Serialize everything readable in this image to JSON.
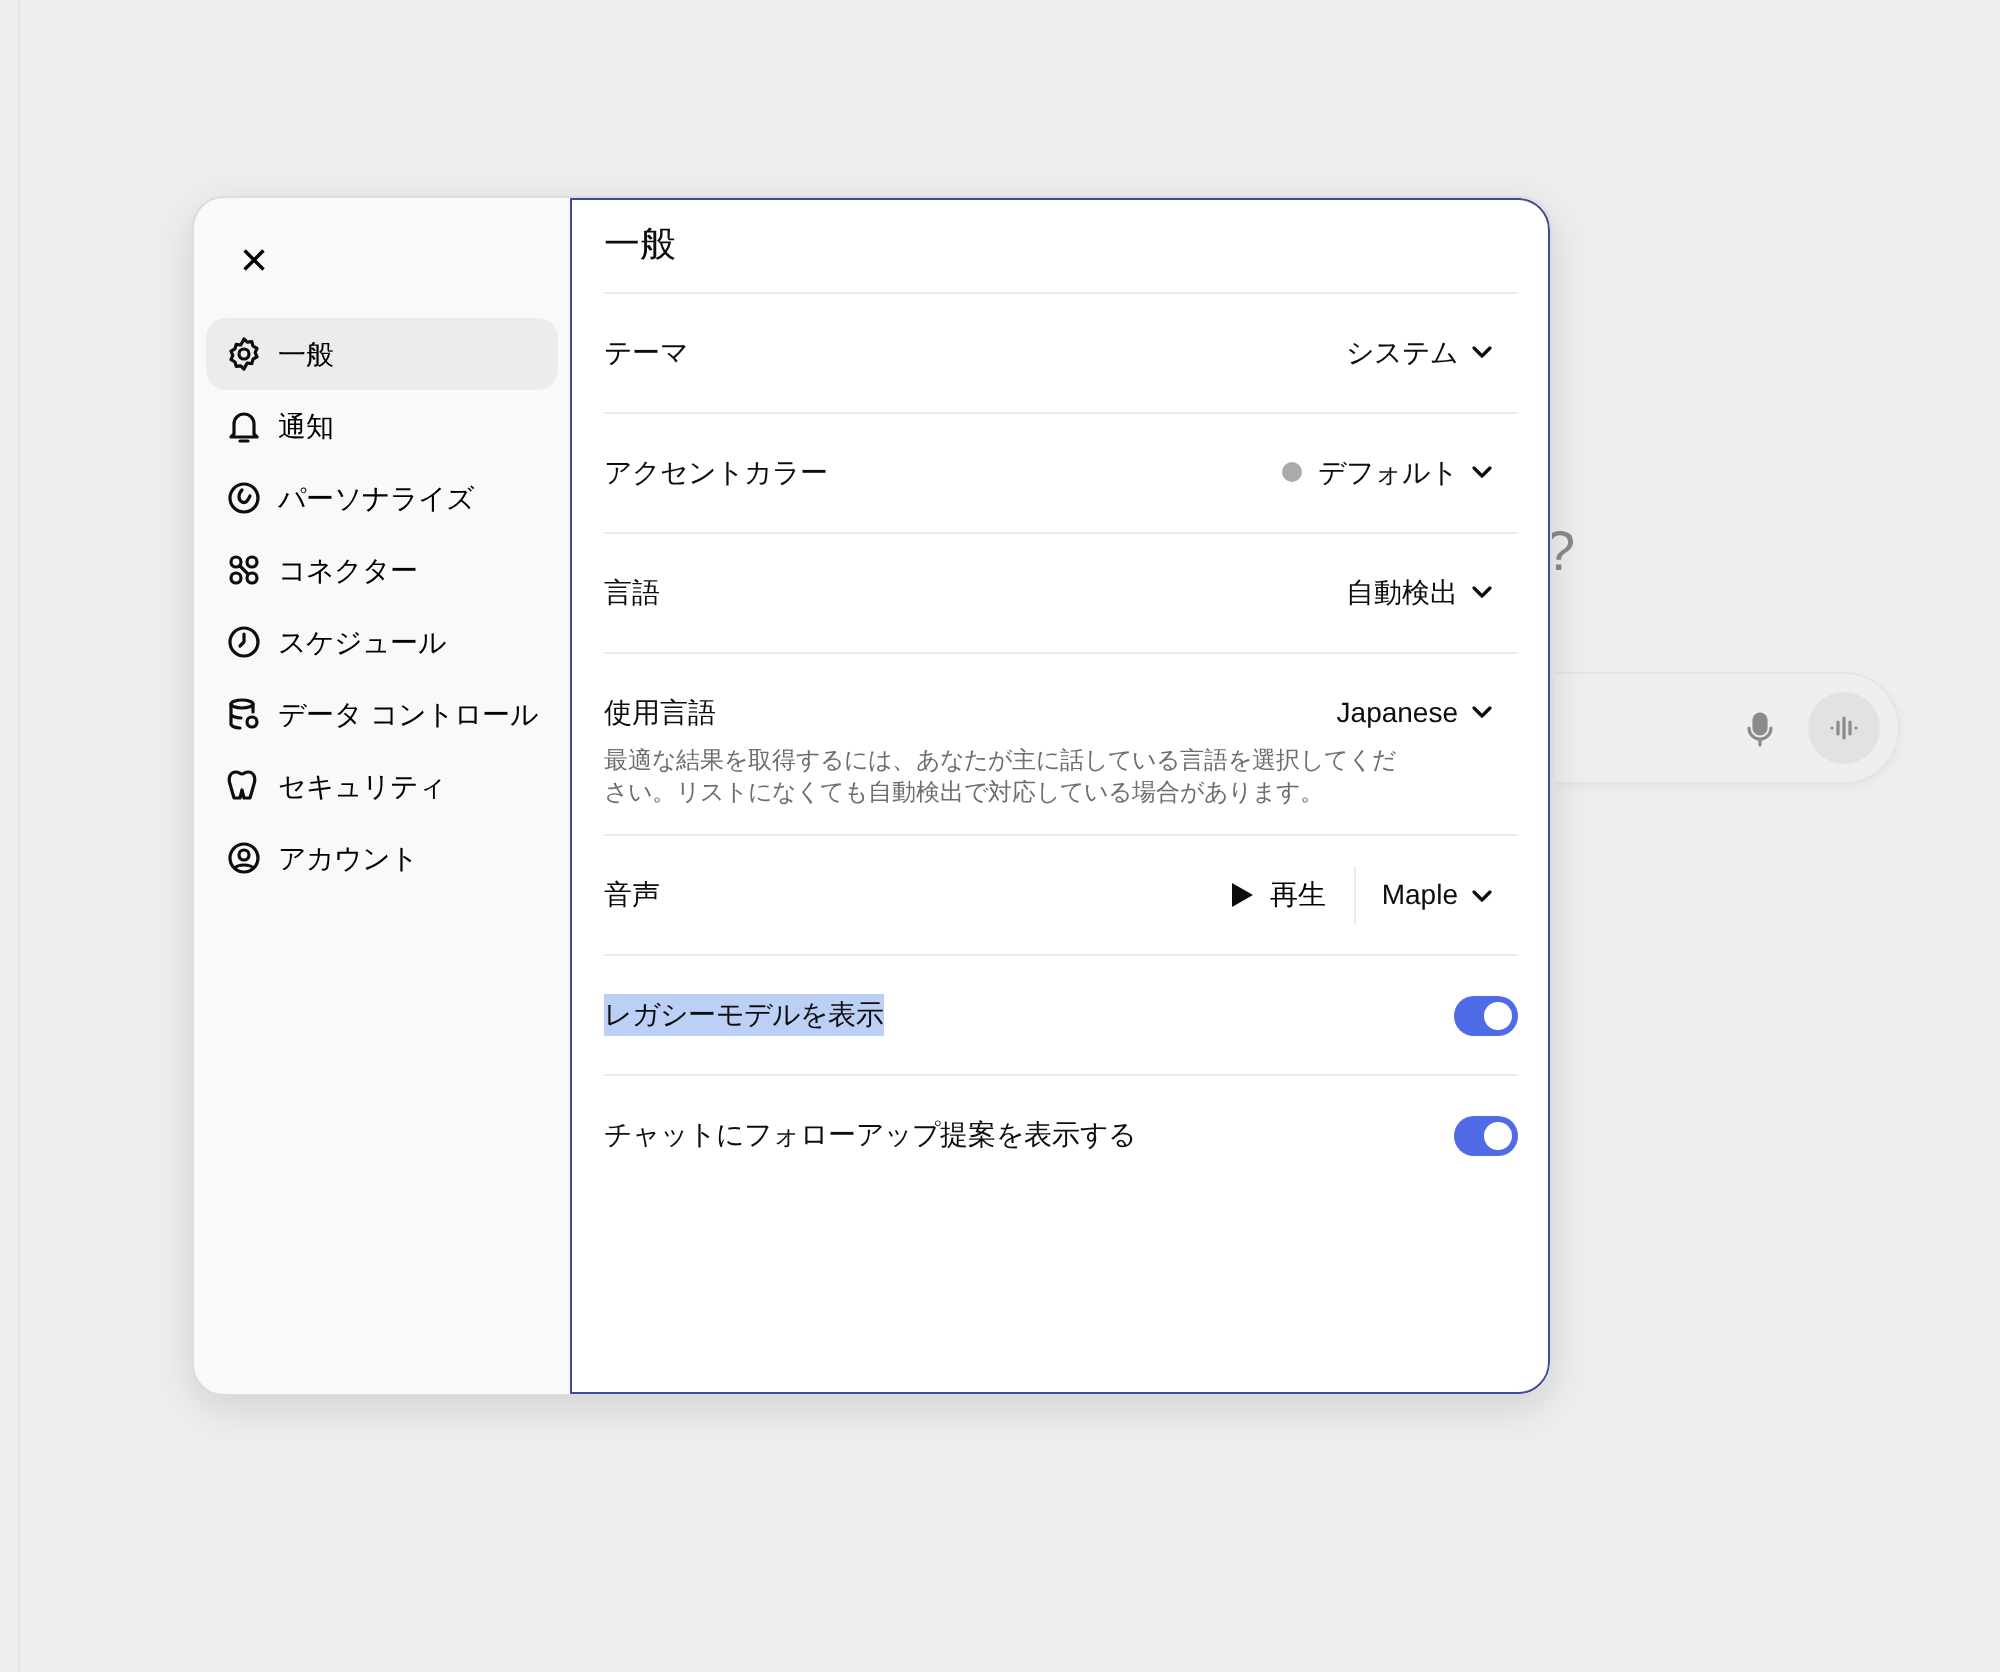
{
  "background": {
    "heading_fragment": "?"
  },
  "dialog": {
    "close": "×",
    "sidebar": [
      {
        "label": "一般",
        "selected": true
      },
      {
        "label": "通知",
        "selected": false
      },
      {
        "label": "パーソナライズ",
        "selected": false
      },
      {
        "label": "コネクター",
        "selected": false
      },
      {
        "label": "スケジュール",
        "selected": false
      },
      {
        "label": "データ コントロール",
        "selected": false
      },
      {
        "label": "セキュリティ",
        "selected": false
      },
      {
        "label": "アカウント",
        "selected": false
      }
    ],
    "title": "一般",
    "rows": [
      {
        "kind": "select",
        "label": "テーマ",
        "value": "システム"
      },
      {
        "kind": "select",
        "label": "アクセントカラー",
        "value": "デフォルト",
        "color": "#aaaaaa"
      },
      {
        "kind": "select",
        "label": "言語",
        "value": "自動検出"
      },
      {
        "kind": "select",
        "label": "使用言語",
        "value": "Japanese",
        "description": "最適な結果を取得するには、あなたが主に話している言語を選択してください。リストになくても自動検出で対応している場合があります。"
      },
      {
        "kind": "voice",
        "label": "音声",
        "play": "再生",
        "value": "Maple"
      },
      {
        "kind": "toggle",
        "label": "レガシーモデルを表示",
        "on": true,
        "text_selected": true
      },
      {
        "kind": "toggle",
        "label": "チャットにフォローアップ提案を表示する",
        "on": true,
        "text_selected": false
      }
    ]
  }
}
